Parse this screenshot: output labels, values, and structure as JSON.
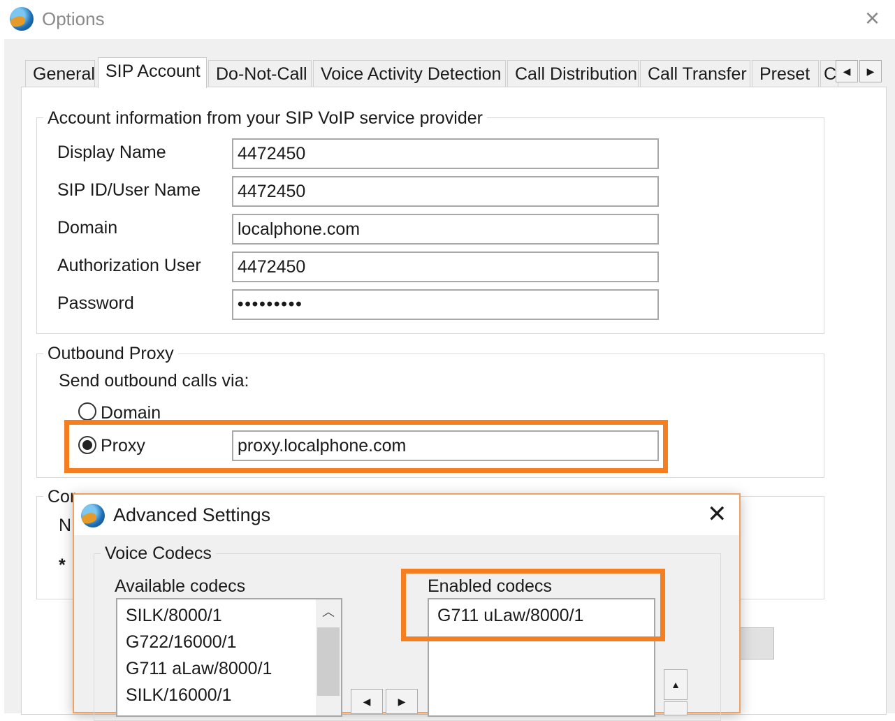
{
  "window": {
    "title": "Options",
    "close_icon": "×"
  },
  "tabs": [
    "General",
    "SIP Account",
    "Do-Not-Call",
    "Voice Activity Detection",
    "Call Distribution",
    "Call Transfer",
    "Preset",
    "C"
  ],
  "tab_scroll": {
    "left": "◀",
    "right": "▶"
  },
  "account": {
    "group_title": "Account information from your SIP VoIP service provider",
    "fields": [
      {
        "label": "Display Name",
        "value": "4472450"
      },
      {
        "label": "SIP ID/User Name",
        "value": "4472450"
      },
      {
        "label": "Domain",
        "value": "localphone.com"
      },
      {
        "label": "Authorization User",
        "value": "4472450"
      },
      {
        "label": "Password",
        "value": "•••••••••"
      }
    ]
  },
  "proxy": {
    "group_title": "Outbound Proxy",
    "send_via": "Send outbound calls via:",
    "domain_label": "Domain",
    "proxy_label": "Proxy",
    "proxy_value": "proxy.localphone.com",
    "selected": "Proxy"
  },
  "third_group": {
    "title_fragment": "Cor",
    "line1": "N",
    "line2": "*"
  },
  "dialog": {
    "title": "Advanced Settings",
    "close_icon": "✕",
    "group_title": "Voice Codecs",
    "available_label": "Available codecs",
    "available": [
      "SILK/8000/1",
      "G722/16000/1",
      "G711 aLaw/8000/1",
      "SILK/16000/1"
    ],
    "enabled_label": "Enabled codecs",
    "enabled": [
      "G711 uLaw/8000/1"
    ],
    "move_left": "◀",
    "move_right": "▶",
    "scroll_up": "▲"
  },
  "colors": {
    "highlight": "#f57f20",
    "client_bg": "#f0f0f0"
  }
}
